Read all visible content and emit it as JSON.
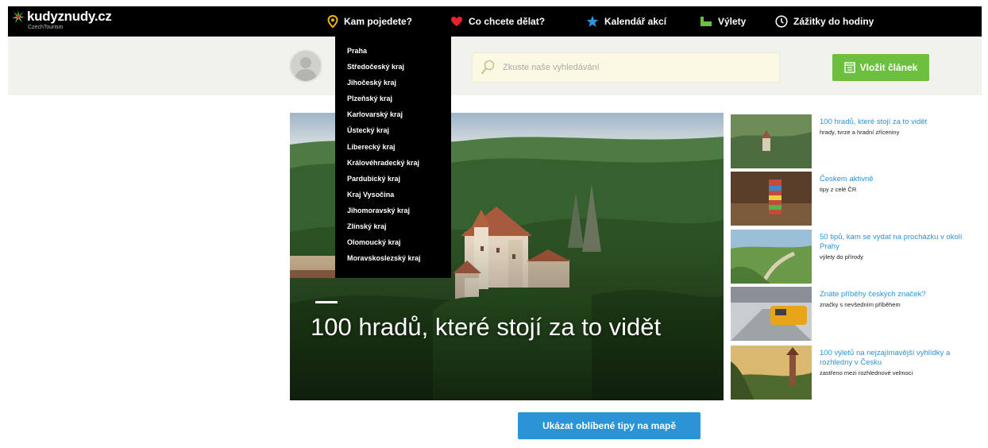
{
  "brand": {
    "name": "kudyznudy.cz",
    "tagline": "CzechTourism"
  },
  "nav": [
    {
      "label": "Kam pojedete?",
      "icon": "location-pin-icon"
    },
    {
      "label": "Co chcete dělat?",
      "icon": "heart-icon"
    },
    {
      "label": "Kalendář akcí",
      "icon": "star-icon"
    },
    {
      "label": "Výlety",
      "icon": "hiking-icon"
    },
    {
      "label": "Zážitky do hodiny",
      "icon": "clock-icon"
    }
  ],
  "search": {
    "placeholder": "Zkuste naše vyhledávání"
  },
  "login": {
    "label": "Vložit článek"
  },
  "dropdown": {
    "items": [
      "Praha",
      "Středočeský kraj",
      "Jihočeský kraj",
      "Plzeňský kraj",
      "Karlovarský kraj",
      "Ústecký kraj",
      "Liberecký kraj",
      "Královéhradecký kraj",
      "Pardubický kraj",
      "Kraj Vysočina",
      "Jihomoravský kraj",
      "Zlínský kraj",
      "Olomoucký kraj",
      "Moravskoslezský kraj"
    ]
  },
  "hero": {
    "title": "100 hradů, které stojí za to vidět"
  },
  "side": [
    {
      "title": "100 hradů, které stojí za to vidět",
      "sub": "hrady, tvrze a hradní zříceniny"
    },
    {
      "title": "Českem aktivně",
      "sub": "tipy z celé ČR"
    },
    {
      "title": "50 tipů, kam se vydat na procházku v okolí Prahy",
      "sub": "výlety do přírody"
    },
    {
      "title": "Znáte příběhy českých značek?",
      "sub": "značky s nevšedním příběhem"
    },
    {
      "title": "100 výletů na nejzajímavější vyhlídky a rozhledny v Česku",
      "sub": "zastřeno mezi rozhlednové velmoci"
    }
  ],
  "map_button": {
    "label": "Ukázat oblíbené tipy na mapě"
  },
  "colors": {
    "accent_blue": "#2a94d6",
    "accent_green": "#6cbf3f",
    "pin": "#f2b51a",
    "heart": "#e8232a",
    "star": "#2a94d6"
  }
}
